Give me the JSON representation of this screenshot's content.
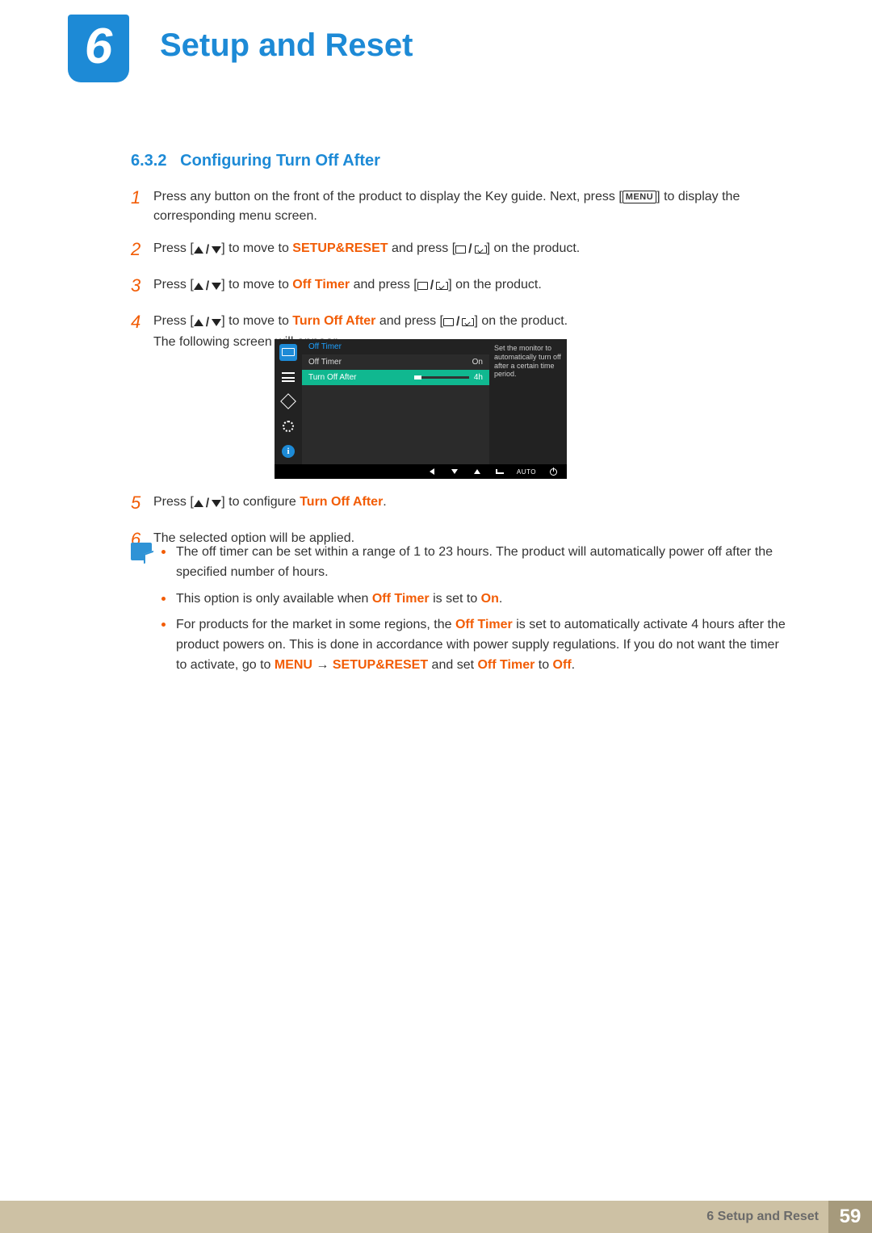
{
  "chapter": {
    "number": "6",
    "title": "Setup and Reset"
  },
  "section": {
    "number": "6.3.2",
    "title": "Configuring Turn Off After"
  },
  "steps": {
    "s1": {
      "num": "1",
      "a": "Press any button on the front of the product to display the Key guide. Next, press [",
      "menu": "MENU",
      "b": "] to display the corresponding menu screen."
    },
    "s2": {
      "num": "2",
      "a": "Press [",
      "b": "] to move to ",
      "hl": "SETUP&RESET",
      "c": " and press [",
      "d": "] on the product."
    },
    "s3": {
      "num": "3",
      "a": "Press [",
      "b": "] to move to ",
      "hl": "Off Timer",
      "c": " and press [",
      "d": "] on the product."
    },
    "s4": {
      "num": "4",
      "a": "Press [",
      "b": "] to move to ",
      "hl": "Turn Off After",
      "c": " and press [",
      "d": "] on the product.",
      "after": "The following screen will appear."
    },
    "s5": {
      "num": "5",
      "a": "Press [",
      "b": "] to configure ",
      "hl": "Turn Off After",
      "c": "."
    },
    "s6": {
      "num": "6",
      "a": "The selected option will be applied."
    }
  },
  "osd": {
    "title": "Off Timer",
    "rows": {
      "r1": {
        "label": "Off Timer",
        "value": "On"
      },
      "r2": {
        "label": "Turn Off After",
        "value": "4h"
      }
    },
    "desc": "Set the monitor to automatically turn off after a certain time period.",
    "nav_auto": "AUTO"
  },
  "notes": {
    "n1": "The off timer can be set within a range of 1 to 23 hours. The product will automatically power off after the specified number of hours.",
    "n2": {
      "a": "This option is only available when ",
      "hl1": "Off Timer",
      "b": " is set to ",
      "hl2": "On",
      "c": "."
    },
    "n3": {
      "a": "For products for the market in some regions, the ",
      "hl1": "Off Timer",
      "b": " is set to automatically activate 4 hours after the product powers on. This is done in accordance with power supply regulations. If you do not want the timer to activate, go to ",
      "hl2": "MENU",
      "arrow": "  →  ",
      "hl3": "SETUP&RESET",
      "c": " and set ",
      "hl4": "Off Timer",
      "d": " to ",
      "hl5": "Off",
      "e": "."
    }
  },
  "footer": {
    "label": "6 Setup and Reset",
    "page": "59"
  }
}
